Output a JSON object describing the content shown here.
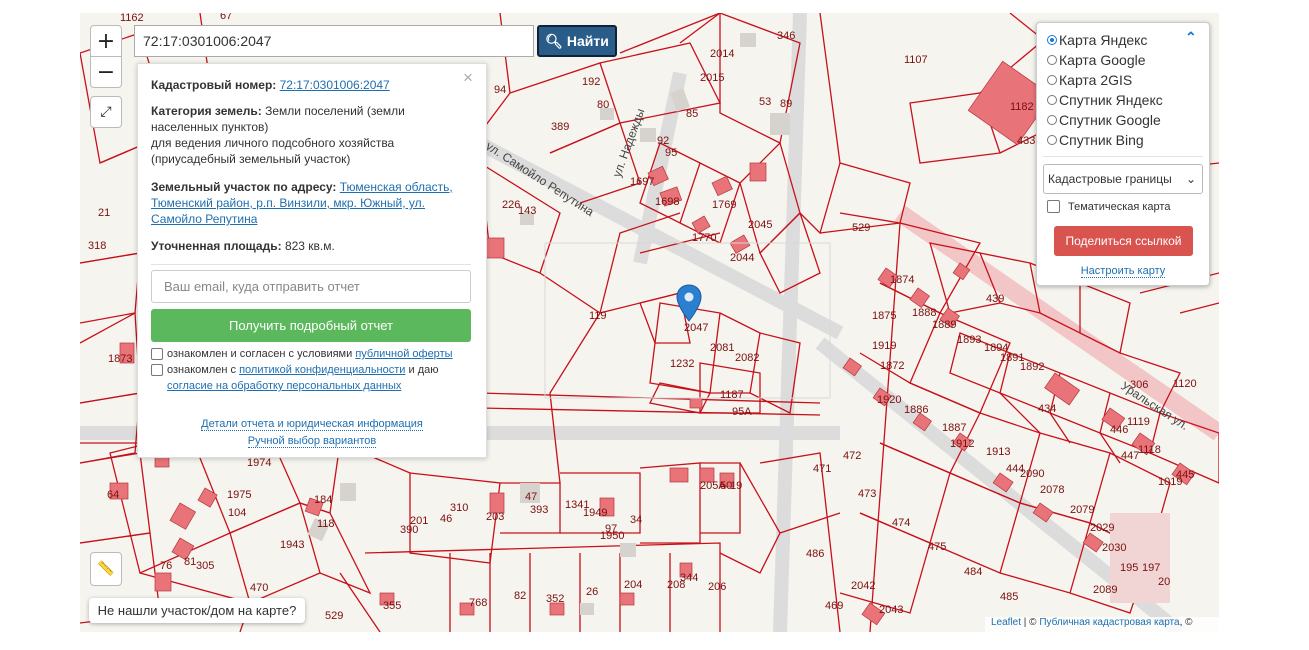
{
  "search": {
    "value": "72:17:0301006:2047",
    "button_label": "Найти"
  },
  "zoom": {
    "in_label": "+",
    "out_label": "−"
  },
  "info": {
    "cadastral_label": "Кадастровый номер:",
    "cadastral_value": "72:17:0301006:2047",
    "category_label": "Категория земель:",
    "category_value_1": "Земли поселений (земли",
    "category_value_2": "населенных пунктов)",
    "category_value_3": "для ведения личного подсобного хозяйства",
    "category_value_4": "(приусадебный земельный участок)",
    "address_label": "Земельный участок по адресу:",
    "address_1": "Тюменская область,",
    "address_2": "Тюменский район, р.п. Винзили, мкр. Южный, ул.",
    "address_3": "Самойло Репутина",
    "area_label": "Уточненная площадь:",
    "area_value": "823 кв.м.",
    "email_placeholder": "Ваш email, куда отправить отчет",
    "get_report_label": "Получить подробный отчет",
    "consent1_text": "ознакомлен и согласен с условиями",
    "consent1_link": "публичной оферты",
    "consent2_text": "ознакомлен с",
    "consent2_link": "политикой конфиденциальности",
    "consent2_text2": "и даю",
    "consent2_link2": "согласие на обработку персональных данных",
    "details_link": "Детали отчета и юридическая информация",
    "manual_link": "Ручной выбор вариантов",
    "close": "×"
  },
  "layers": {
    "options": [
      "Карта Яндекс",
      "Карта Google",
      "Карта 2GIS",
      "Спутник Яндекс",
      "Спутник Google",
      "Спутник Bing"
    ],
    "selected": "Карта Яндекс",
    "boundaries_select": "Кадастровые границы",
    "thematic_label": "Тематическая карта",
    "share_label": "Поделиться ссылкой",
    "configure_link": "Настроить карту"
  },
  "not_found_label": "Не нашли участок/дом на карте?",
  "attribution": {
    "leaflet": "Leaflet",
    "sep": " | © ",
    "source": "Публичная кадастровая карта",
    "tail": ", ©"
  },
  "map": {
    "street_1": "ул. Самойло Репутина",
    "street_2": "ул. Надежды",
    "street_3": "Уральская ул.",
    "parcel_labels": [
      "1162",
      "67",
      "346",
      "1107",
      "2014",
      "2015",
      "192",
      "94",
      "80",
      "85",
      "53",
      "89",
      "1182",
      "433",
      "389",
      "92",
      "95",
      "1697",
      "1698",
      "1769",
      "2045",
      "1770",
      "2044",
      "226",
      "143",
      "529",
      "21",
      "318",
      "119",
      "2047",
      "2081",
      "2082",
      "1232",
      "1187",
      "95А",
      "1874",
      "1875",
      "1888",
      "1889",
      "1893",
      "1894",
      "1891",
      "1892",
      "439",
      "306",
      "1873",
      "1872",
      "1919",
      "1920",
      "1886",
      "1887",
      "1912",
      "1913",
      "444",
      "434",
      "1120",
      "1119",
      "1118",
      "445",
      "446",
      "447",
      "1019",
      "1974",
      "1975",
      "104",
      "64",
      "184",
      "118",
      "1943",
      "81",
      "305",
      "76",
      "470",
      "471",
      "472",
      "473",
      "474",
      "475",
      "484",
      "485",
      "486",
      "469",
      "2042",
      "2043",
      "2089",
      "2090",
      "2078",
      "2079",
      "2029",
      "2030",
      "195",
      "197",
      "20",
      "201",
      "310",
      "203",
      "47",
      "393",
      "1341",
      "1949",
      "1950",
      "34",
      "19",
      "205А",
      "50",
      "390",
      "46",
      "97",
      "355",
      "768",
      "352",
      "82",
      "26",
      "204",
      "206",
      "208",
      "344",
      "529"
    ]
  }
}
